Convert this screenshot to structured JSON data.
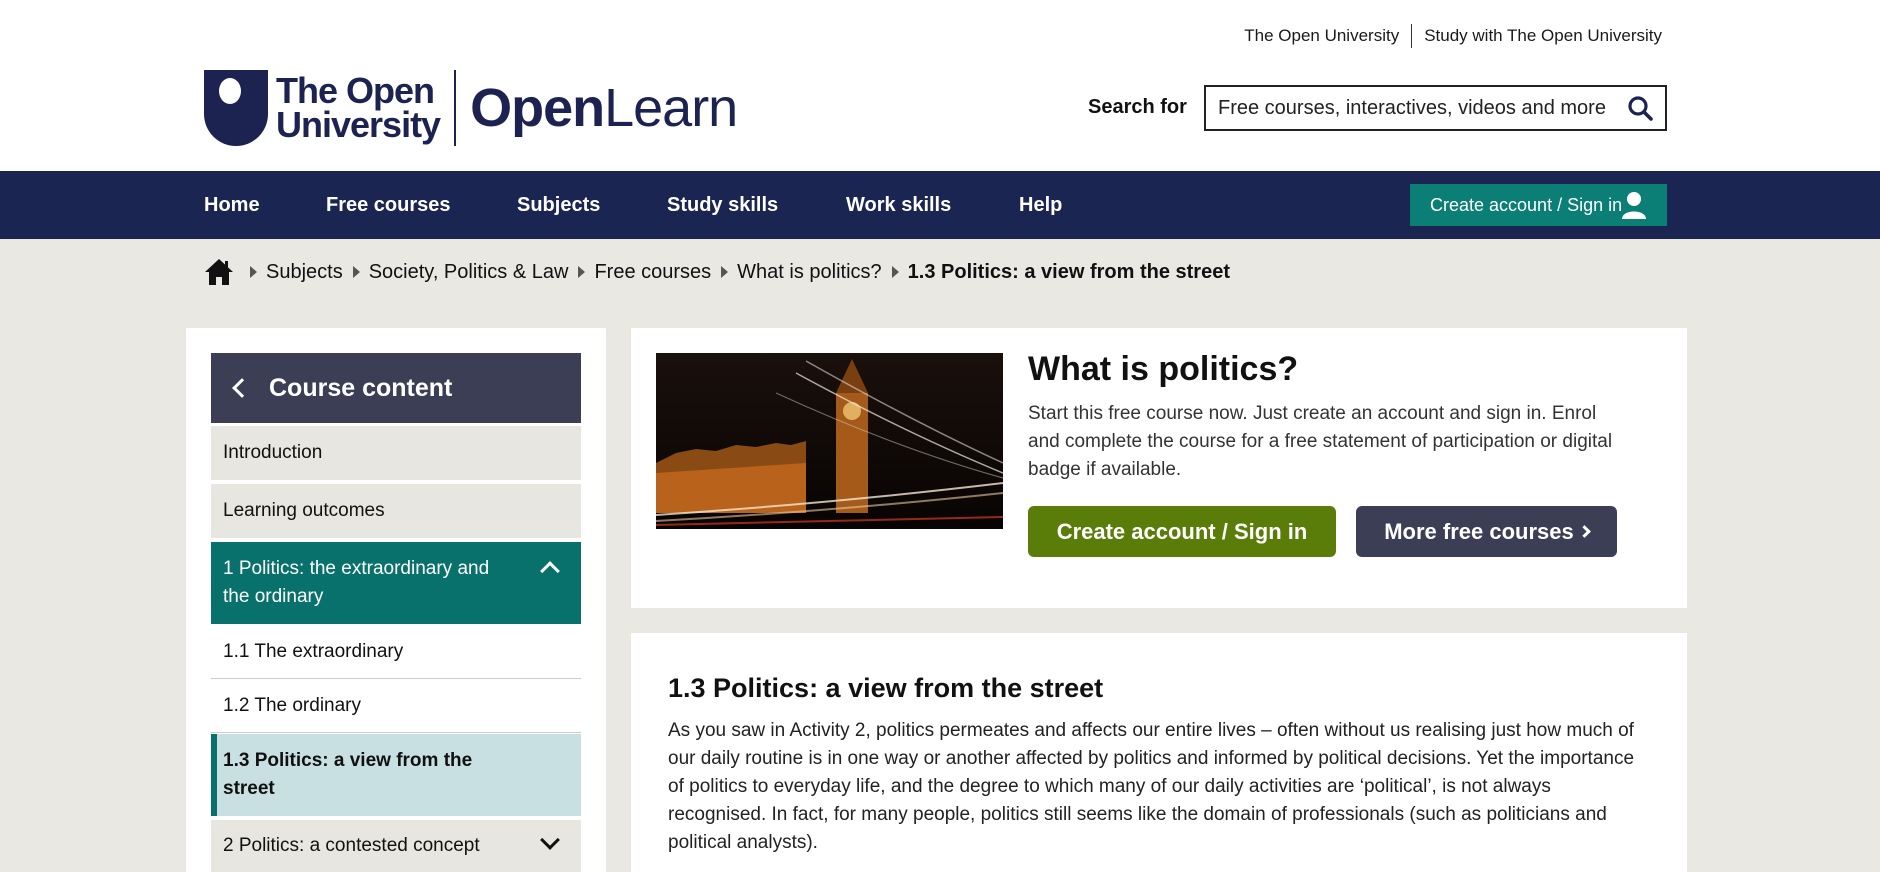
{
  "toplinks": {
    "ou": "The Open University",
    "study": "Study with The Open University"
  },
  "logo": {
    "ou_line1": "The Open",
    "ou_line2": "University",
    "openlearn_bold": "Open",
    "openlearn_light": "Learn"
  },
  "search": {
    "label": "Search for",
    "placeholder": "Free courses, interactives, videos and more",
    "icon": "search-icon"
  },
  "nav": {
    "items": [
      "Home",
      "Free courses",
      "Subjects",
      "Study skills",
      "Work skills",
      "Help"
    ],
    "signin_label": "Create account / Sign in",
    "signin_icon": "user-icon"
  },
  "breadcrumb": {
    "home_icon": "home-icon",
    "items": [
      "Subjects",
      "Society, Politics & Law",
      "Free courses",
      "What is politics?"
    ],
    "current": "1.3 Politics: a view from the street"
  },
  "sidebar": {
    "header": "Course content",
    "items": [
      "Introduction",
      "Learning outcomes",
      "1 Politics: the extraordinary and the ordinary",
      "1.1 The extraordinary",
      "1.2 The ordinary",
      "1.3 Politics: a view from the street",
      "2 Politics: a contested concept"
    ]
  },
  "course_card": {
    "title": "What is politics?",
    "description": "Start this free course now. Just create an account and sign in. Enrol and complete the course for a free statement of participation or digital badge if available.",
    "primary_button": "Create account / Sign in",
    "secondary_button": "More free courses"
  },
  "article": {
    "title": "1.3 Politics: a view from the street",
    "body": "As you saw in Activity 2, politics permeates and affects our entire lives – often without us realising just how much of our daily routine is in one way or another affected by politics and informed by political decisions. Yet the importance of politics to everyday life, and the degree to which many of our daily activities are ‘political’, is not always recognised. In fact, for many people, politics still seems like the domain of professionals (such as politicians and political analysts)."
  },
  "colors": {
    "navy": "#1b2552",
    "teal": "#0b7e76",
    "green": "#5a7d0a",
    "slate": "#3b3e55",
    "page_bg": "#e9e8e3"
  }
}
